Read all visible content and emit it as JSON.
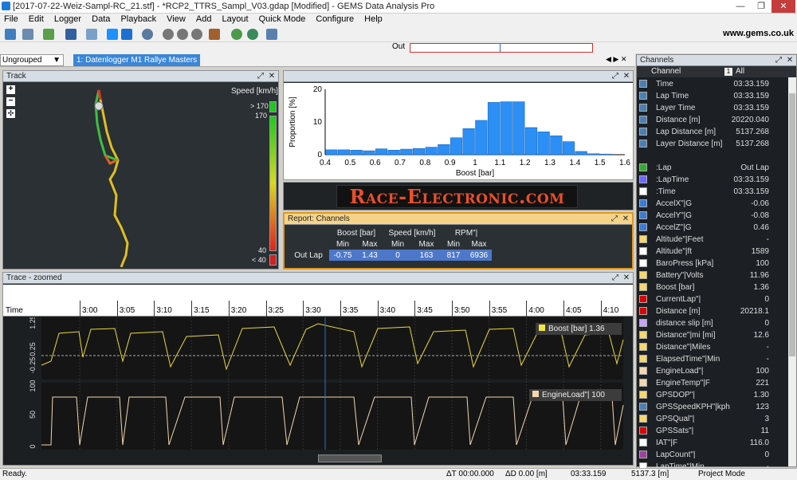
{
  "window": {
    "title": "[2017-07-22-Weiz-Sampl-RC_21.stf] - *RCP2_TTRS_Sampl_V03.gdap [Modified] - GEMS Data Analysis Pro",
    "min": "—",
    "restore": "❐",
    "close": "✕"
  },
  "menu": [
    "File",
    "Edit",
    "Logger",
    "Data",
    "Playback",
    "View",
    "Add",
    "Layout",
    "Quick Mode",
    "Configure",
    "Help"
  ],
  "toolbar": {
    "url": "www.gems.co.uk",
    "out_label": "Out"
  },
  "tabs": {
    "group_select": "Ungrouped",
    "active_tab": "1: Datenlogger M1 Rallye Masters"
  },
  "track": {
    "title": "Track",
    "speed_label": "Speed [km/h]",
    "legend": [
      "> 170",
      "170",
      "40",
      "< 40"
    ],
    "zoom_in": "+",
    "zoom_out": "−",
    "fit": "✣"
  },
  "histogram": {
    "title": "",
    "chart_data": {
      "type": "bar",
      "xlabel": "Boost [bar]",
      "ylabel": "Proportion [%]",
      "ylim": [
        0,
        20
      ],
      "xlim": [
        0.4,
        1.6
      ],
      "yticks": [
        "0",
        "10",
        "20"
      ],
      "xticks": [
        "0.4",
        "0.5",
        "0.6",
        "0.7",
        "0.8",
        "0.9",
        "1",
        "1.1",
        "1.2",
        "1.3",
        "1.4",
        "1.5",
        "1.6"
      ],
      "x": [
        0.425,
        0.475,
        0.525,
        0.575,
        0.625,
        0.675,
        0.725,
        0.775,
        0.825,
        0.875,
        0.925,
        0.975,
        1.025,
        1.075,
        1.125,
        1.175,
        1.225,
        1.275,
        1.325,
        1.375,
        1.425,
        1.475,
        1.525
      ],
      "values": [
        1.5,
        1.5,
        1.4,
        1.2,
        1.8,
        1.4,
        1.7,
        1.9,
        2.3,
        3.1,
        5.2,
        8.0,
        10.5,
        16.0,
        16.2,
        16.2,
        8.3,
        7.0,
        5.8,
        4.0,
        1.0,
        0.3,
        0.2
      ]
    }
  },
  "logo": {
    "text": "Race-Electronic.com"
  },
  "report": {
    "title": "Report: Channels",
    "groups": [
      "Boost [bar]",
      "Speed [km/h]",
      "RPM\"|"
    ],
    "subheads": [
      "Min",
      "Max",
      "Min",
      "Max",
      "Min",
      "Max"
    ],
    "row_label": "Out Lap",
    "values": [
      "-0.75",
      "1.43",
      "0",
      "163",
      "817",
      "6936"
    ]
  },
  "trace": {
    "title": "Trace - zoomed",
    "time_label": "Time",
    "times": [
      "3:00",
      "3:05",
      "3:10",
      "3:15",
      "3:20",
      "3:25",
      "3:30",
      "3:35",
      "3:40",
      "3:45",
      "3:50",
      "3:55",
      "4:00",
      "4:05",
      "4:10"
    ],
    "channel1": {
      "legend": "Boost [bar] 1.36",
      "yticks": [
        "1.25",
        "0.25",
        "-0.25"
      ]
    },
    "channel2": {
      "legend": "EngineLoad\"| 100",
      "yticks": [
        "100",
        "50",
        "0"
      ]
    }
  },
  "channels": {
    "title": "Channels",
    "col_channel": "Channel",
    "col_all": "All",
    "rows": [
      {
        "n": "Time",
        "v": "03:33.159",
        "c": "#4a7fb5"
      },
      {
        "n": "Lap Time",
        "v": "03:33.159",
        "c": "#4a7fb5"
      },
      {
        "n": "Layer Time",
        "v": "03:33.159",
        "c": "#4a7fb5"
      },
      {
        "n": "Distance [m]",
        "v": "20220.040",
        "c": "#4a7fb5"
      },
      {
        "n": "Lap Distance [m]",
        "v": "5137.268",
        "c": "#4a7fb5"
      },
      {
        "n": "Layer Distance [m]",
        "v": "5137.268",
        "c": "#4a7fb5"
      },
      {
        "n": "",
        "v": "",
        "c": ""
      },
      {
        "n": ":Lap",
        "v": "Out Lap",
        "c": "#3a3"
      },
      {
        "n": ":LapTime",
        "v": "03:33.159",
        "c": "#6a6aff"
      },
      {
        "n": ":Time",
        "v": "03:33.159",
        "c": "#ffffff"
      },
      {
        "n": "AccelX\"|G",
        "v": "-0.06",
        "c": "#3a7bd5"
      },
      {
        "n": "AccelY\"|G",
        "v": "-0.08",
        "c": "#3a7bd5"
      },
      {
        "n": "AccelZ\"|G",
        "v": "0.46",
        "c": "#3a7bd5"
      },
      {
        "n": "Altitude\"|Feet",
        "v": "-",
        "c": "#f5d76e"
      },
      {
        "n": "Altitude\"|ft",
        "v": "1589",
        "c": "#fff"
      },
      {
        "n": "BaroPress [kPa]",
        "v": "100",
        "c": "#fff"
      },
      {
        "n": "Battery\"|Volts",
        "v": "11.96",
        "c": "#f5d76e"
      },
      {
        "n": "Boost [bar]",
        "v": "1.36",
        "c": "#f5d76e"
      },
      {
        "n": "CurrentLap\"|",
        "v": "0",
        "c": "#d00"
      },
      {
        "n": "Distance [m]",
        "v": "20218.1",
        "c": "#d00"
      },
      {
        "n": "distance slip [m]",
        "v": "0",
        "c": "#c8a2ff"
      },
      {
        "n": "Distance\"|mi [mi]",
        "v": "12.6",
        "c": "#f5d76e"
      },
      {
        "n": "Distance\"|Miles",
        "v": "-",
        "c": "#f5d76e"
      },
      {
        "n": "ElapsedTime\"|Min",
        "v": "-",
        "c": "#f5d76e"
      },
      {
        "n": "EngineLoad\"|",
        "v": "100",
        "c": "#f2d7b0"
      },
      {
        "n": "EngineTemp\"|F",
        "v": "221",
        "c": "#f2d7b0"
      },
      {
        "n": "GPSDOP\"|",
        "v": "1.30",
        "c": "#f5d76e"
      },
      {
        "n": "GPSSpeedKPH\"|kph",
        "v": "123",
        "c": "#4a7fb5"
      },
      {
        "n": "GPSQual\"|",
        "v": "3",
        "c": "#f5d76e"
      },
      {
        "n": "GPSSats\"|",
        "v": "11",
        "c": "#d00"
      },
      {
        "n": "IAT\"|F",
        "v": "116.0",
        "c": "#fff"
      },
      {
        "n": "LapCount\"|",
        "v": "0",
        "c": "#a040a0"
      },
      {
        "n": "LapTime\"|Min",
        "v": "-",
        "c": "#fff"
      }
    ]
  },
  "status": {
    "ready": "Ready.",
    "dt": "ΔT 00:00.000",
    "dd": "ΔD 0.00 [m]",
    "time": "03:33.159",
    "dist": "5137.3 [m]",
    "mode": "Project Mode"
  }
}
